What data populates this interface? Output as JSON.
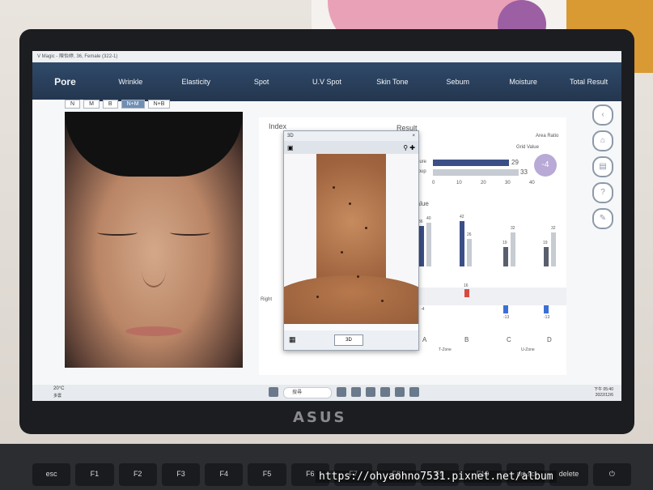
{
  "app": {
    "window_title": "V Magic - 陳怡婷, 36, Female (322-1)",
    "tabs": [
      "Pore",
      "Wrinkle",
      "Elasticity",
      "Spot",
      "U.V Spot",
      "Skin Tone",
      "Sebum",
      "Moisture",
      "Total Result"
    ],
    "active_tab": "Pore"
  },
  "left_panel": {
    "modes": [
      "N",
      "M",
      "B",
      "N+M",
      "N+B"
    ],
    "active_mode": "N+M"
  },
  "right_panel": {
    "index_label": "Index",
    "result_label": "Result",
    "area_label": "Area Ratio",
    "grid_value": "Grid Value",
    "figure_label": "Figure",
    "group_label": "Group",
    "figure_value": "29",
    "group_value": "33",
    "axis_ticks": [
      "0",
      "10",
      "20",
      "30",
      "40"
    ],
    "score_badge": "-4",
    "value_label": "Value",
    "right_label": "Right",
    "zones": [
      "A",
      "B",
      "C",
      "D"
    ],
    "zone_groups": [
      "T-Zone",
      "U-Zone"
    ],
    "bar_values": [
      "36",
      "40",
      "42",
      "26",
      "19",
      "32",
      "19",
      "32"
    ],
    "diff_values": [
      "-4",
      "16",
      "-13",
      "-13"
    ]
  },
  "popup": {
    "title": "3D",
    "button_3d": "3D"
  },
  "taskbar": {
    "weather_temp": "20°C",
    "weather_desc": "多雲",
    "search": "搜尋",
    "date": "2022/12/6",
    "time": "下午 05:40"
  },
  "hardware": {
    "brand": "ASUS",
    "keyboard_keys": [
      "esc",
      "F1",
      "F2",
      "F3",
      "F4",
      "F5",
      "F6",
      "F7",
      "F8",
      "F9",
      "F10",
      "prt sc",
      "delete",
      "⏻"
    ]
  },
  "watermark": "https://ohyaohno7531.pixnet.net/album",
  "colors": {
    "tab_bar": "#2f4a6a",
    "bar_blue": "#3b4f86",
    "bar_gray": "#c7cbd2",
    "bar_red": "#d84a3f"
  }
}
